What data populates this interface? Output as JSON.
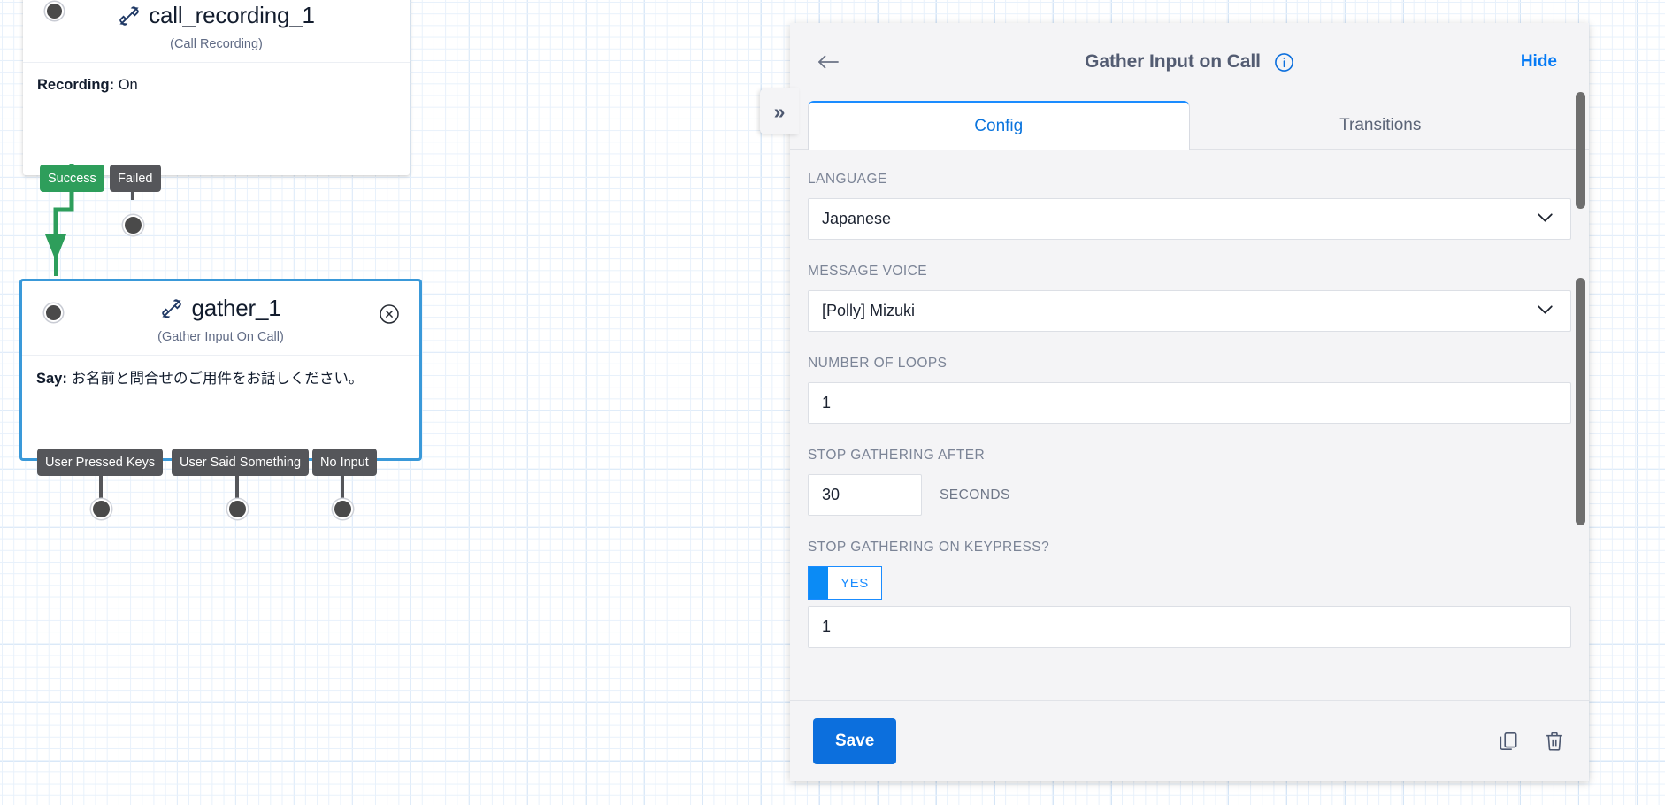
{
  "canvas": {
    "nodes": [
      {
        "id": "call_recording_1",
        "title": "call_recording_1",
        "type_label": "(Call Recording)",
        "icon": "phone-call-icon",
        "body_key": "Recording:",
        "body_value": "On",
        "transitions": [
          {
            "label": "Success",
            "kind": "success"
          },
          {
            "label": "Failed",
            "kind": "default"
          }
        ]
      },
      {
        "id": "gather_1",
        "title": "gather_1",
        "type_label": "(Gather Input On Call)",
        "icon": "phone-call-icon",
        "body_key": "Say:",
        "body_value": "お名前と問合せのご用件をお話しください。",
        "selected": true,
        "close_icon": "close-circle-icon",
        "transitions": [
          {
            "label": "User Pressed Keys",
            "kind": "default"
          },
          {
            "label": "User Said Something",
            "kind": "default"
          },
          {
            "label": "No Input",
            "kind": "default"
          }
        ]
      }
    ],
    "colors": {
      "success": "#2e9e5b",
      "default_transition": "#55565a",
      "selection": "#3a99d9",
      "grid_minor": "#e8f1fb",
      "grid_major": "#d6e6f7"
    }
  },
  "panel": {
    "back_icon": "back-arrow-icon",
    "title": "Gather Input on Call",
    "info_icon": "info-circle-icon",
    "hide_label": "Hide",
    "collapse_icon": "chevron-double-right-icon",
    "collapse_glyph": "»",
    "tabs": [
      {
        "label": "Config",
        "active": true
      },
      {
        "label": "Transitions",
        "active": false
      }
    ],
    "fields": {
      "language": {
        "label": "LANGUAGE",
        "value": "Japanese",
        "chevron_icon": "chevron-down-icon"
      },
      "message_voice": {
        "label": "MESSAGE VOICE",
        "value": "[Polly] Mizuki",
        "chevron_icon": "chevron-down-icon"
      },
      "number_of_loops": {
        "label": "NUMBER OF LOOPS",
        "value": "1"
      },
      "stop_gathering_after": {
        "label": "STOP GATHERING AFTER",
        "value": "30",
        "unit": "SECONDS"
      },
      "stop_on_keypress": {
        "label": "STOP GATHERING ON KEYPRESS?",
        "toggle_value": "YES",
        "toggle_on": true,
        "extra_value": "1"
      }
    },
    "footer": {
      "save_label": "Save",
      "copy_icon": "copy-icon",
      "delete_icon": "trash-icon"
    },
    "accent_color": "#0c6fdd",
    "toggle_color": "#0b8bf5"
  }
}
